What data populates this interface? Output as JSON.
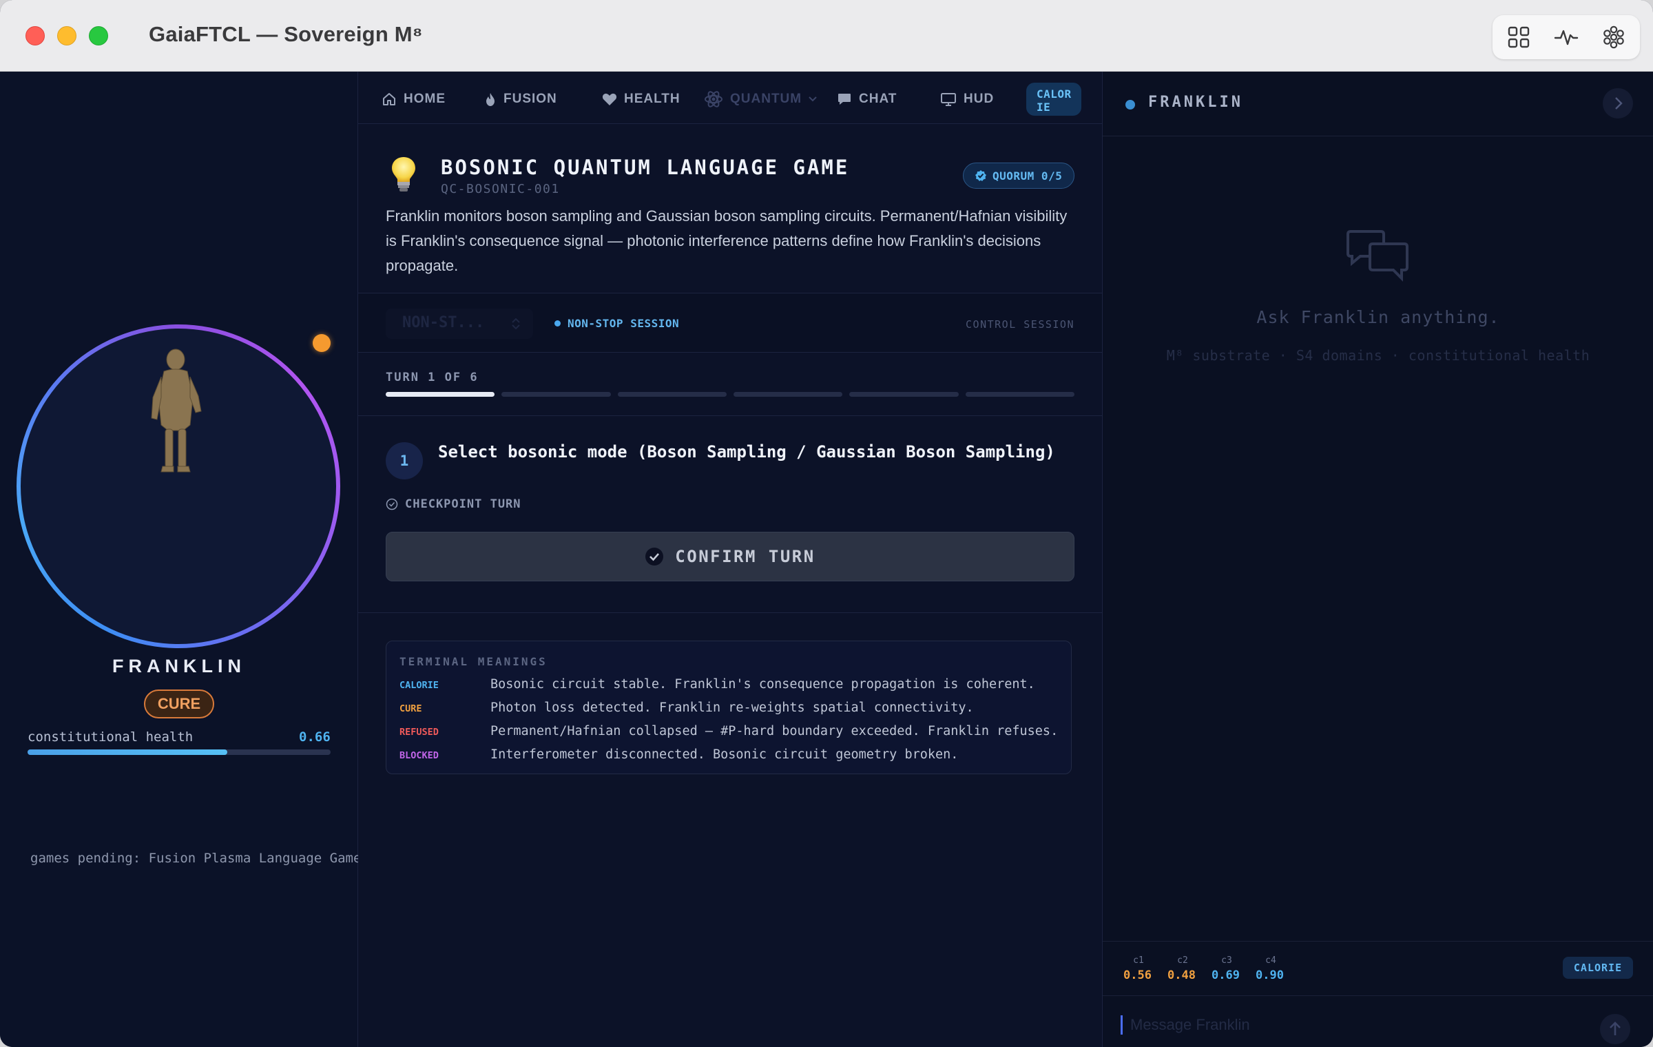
{
  "window": {
    "title": "GaiaFTCL — Sovereign M⁸"
  },
  "toolbar": {
    "icons": [
      "grid-icon",
      "pulse-icon",
      "flower-icon"
    ]
  },
  "left": {
    "character_name": "FRANKLIN",
    "status_badge": "CURE",
    "health_label": "constitutional health",
    "health_value": "0.66",
    "health_fraction": 0.66,
    "pending": "games pending: Fusion Plasma Language Game,"
  },
  "tabs": [
    {
      "label": "HOME",
      "icon": "home-icon"
    },
    {
      "label": "FUSION",
      "icon": "flame-icon"
    },
    {
      "label": "HEALTH",
      "icon": "heart-icon"
    },
    {
      "label": "QUANTUM",
      "icon": "atom-icon"
    },
    {
      "label": "CHAT",
      "icon": "chat-icon"
    },
    {
      "label": "HUD",
      "icon": "monitor-icon"
    }
  ],
  "tab_status": {
    "line1": "CALOR",
    "line2": "IE"
  },
  "game": {
    "title": "BOSONIC QUANTUM LANGUAGE GAME",
    "code": "QC-BOSONIC-001",
    "quorum": "QUORUM 0/5",
    "description": "Franklin monitors boson sampling and Gaussian boson sampling circuits. Permanent/Hafnian visibility is Franklin's consequence signal — photonic interference patterns define how Franklin's decisions propagate."
  },
  "session": {
    "mode_value": "NON-ST...",
    "mode_label": "NON-STOP SESSION",
    "control_label": "CONTROL SESSION"
  },
  "turn": {
    "label": "TURN 1 OF 6",
    "current": 1,
    "total": 6,
    "step_number": "1",
    "step_text": "Select bosonic mode (Boson Sampling / Gaussian Boson Sampling)",
    "checkpoint": "CHECKPOINT TURN",
    "confirm": "CONFIRM TURN"
  },
  "terminal": {
    "title": "TERMINAL MEANINGS",
    "rows": [
      {
        "key": "CALORIE",
        "color": "#4fb3f0",
        "text": "Bosonic circuit stable. Franklin's consequence propagation is coherent."
      },
      {
        "key": "CURE",
        "color": "#f0a040",
        "text": "Photon loss detected. Franklin re-weights spatial connectivity."
      },
      {
        "key": "REFUSED",
        "color": "#ef5a5a",
        "text": "Permanent/Hafnian collapsed — #P-hard boundary exceeded. Franklin refuses."
      },
      {
        "key": "BLOCKED",
        "color": "#c165e8",
        "text": "Interferometer disconnected. Bosonic circuit geometry broken."
      }
    ]
  },
  "chat": {
    "name": "FRANKLIN",
    "empty_title": "Ask Franklin anything.",
    "empty_sub": "M⁸ substrate · S4 domains · constitutional health",
    "metrics": [
      {
        "key": "c1",
        "value": "0.56",
        "color": "#f0a040"
      },
      {
        "key": "c2",
        "value": "0.48",
        "color": "#f0a040"
      },
      {
        "key": "c3",
        "value": "0.69",
        "color": "#4fb3f0"
      },
      {
        "key": "c4",
        "value": "0.90",
        "color": "#4fb3f0"
      }
    ],
    "state": "CALORIE",
    "placeholder": "Message Franklin"
  }
}
